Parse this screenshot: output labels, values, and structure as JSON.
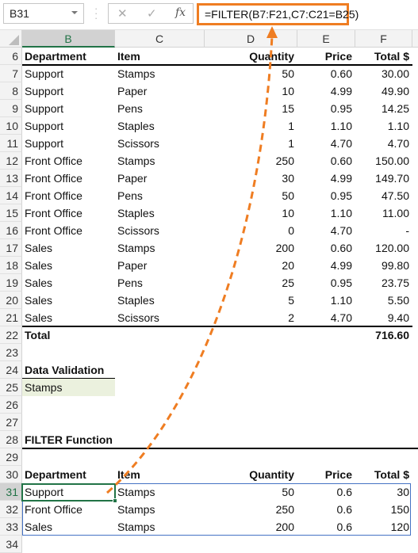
{
  "formula_bar": {
    "name_box": "B31",
    "cancel_icon": "✕",
    "enter_icon": "✓",
    "fx_label": "fx",
    "formula": "=FILTER(B7:F21,C7:C21=B25)",
    "highlight_color": "#ef7d22"
  },
  "columns": [
    "B",
    "C",
    "D",
    "E",
    "F"
  ],
  "selected_cell": "B31",
  "source_table": {
    "headers": [
      "Department",
      "Item",
      "Quantity",
      "Price",
      "Total  $"
    ],
    "rows": [
      {
        "row": "7",
        "dept": "Support",
        "item": "Stamps",
        "qty": "50",
        "price": "0.60",
        "total": "30.00"
      },
      {
        "row": "8",
        "dept": "Support",
        "item": "Paper",
        "qty": "10",
        "price": "4.99",
        "total": "49.90"
      },
      {
        "row": "9",
        "dept": "Support",
        "item": "Pens",
        "qty": "15",
        "price": "0.95",
        "total": "14.25"
      },
      {
        "row": "10",
        "dept": "Support",
        "item": "Staples",
        "qty": "1",
        "price": "1.10",
        "total": "1.10"
      },
      {
        "row": "11",
        "dept": "Support",
        "item": "Scissors",
        "qty": "1",
        "price": "4.70",
        "total": "4.70"
      },
      {
        "row": "12",
        "dept": "Front Office",
        "item": "Stamps",
        "qty": "250",
        "price": "0.60",
        "total": "150.00"
      },
      {
        "row": "13",
        "dept": "Front Office",
        "item": "Paper",
        "qty": "30",
        "price": "4.99",
        "total": "149.70"
      },
      {
        "row": "14",
        "dept": "Front Office",
        "item": "Pens",
        "qty": "50",
        "price": "0.95",
        "total": "47.50"
      },
      {
        "row": "15",
        "dept": "Front Office",
        "item": "Staples",
        "qty": "10",
        "price": "1.10",
        "total": "11.00"
      },
      {
        "row": "16",
        "dept": "Front Office",
        "item": "Scissors",
        "qty": "0",
        "price": "4.70",
        "total": "-"
      },
      {
        "row": "17",
        "dept": "Sales",
        "item": "Stamps",
        "qty": "200",
        "price": "0.60",
        "total": "120.00"
      },
      {
        "row": "18",
        "dept": "Sales",
        "item": "Paper",
        "qty": "20",
        "price": "4.99",
        "total": "99.80"
      },
      {
        "row": "19",
        "dept": "Sales",
        "item": "Pens",
        "qty": "25",
        "price": "0.95",
        "total": "23.75"
      },
      {
        "row": "20",
        "dept": "Sales",
        "item": "Staples",
        "qty": "5",
        "price": "1.10",
        "total": "5.50"
      },
      {
        "row": "21",
        "dept": "Sales",
        "item": "Scissors",
        "qty": "2",
        "price": "4.70",
        "total": "9.40"
      }
    ],
    "total_label": "Total",
    "total_value": "716.60"
  },
  "data_validation": {
    "title": "Data Validation",
    "value": "Stamps"
  },
  "filter_section": {
    "title": "FILTER Function",
    "headers": [
      "Department",
      "Item",
      "Quantity",
      "Price",
      "Total  $"
    ],
    "rows": [
      {
        "row": "31",
        "dept": "Support",
        "item": "Stamps",
        "qty": "50",
        "price": "0.6",
        "total": "30"
      },
      {
        "row": "32",
        "dept": "Front Office",
        "item": "Stamps",
        "qty": "250",
        "price": "0.6",
        "total": "150"
      },
      {
        "row": "33",
        "dept": "Sales",
        "item": "Stamps",
        "qty": "200",
        "price": "0.6",
        "total": "120"
      }
    ]
  },
  "row_numbers": [
    "6",
    "7",
    "8",
    "9",
    "10",
    "11",
    "12",
    "13",
    "14",
    "15",
    "16",
    "17",
    "18",
    "19",
    "20",
    "21",
    "22",
    "23",
    "24",
    "25",
    "26",
    "27",
    "28",
    "29",
    "30",
    "31",
    "32",
    "33",
    "34"
  ]
}
